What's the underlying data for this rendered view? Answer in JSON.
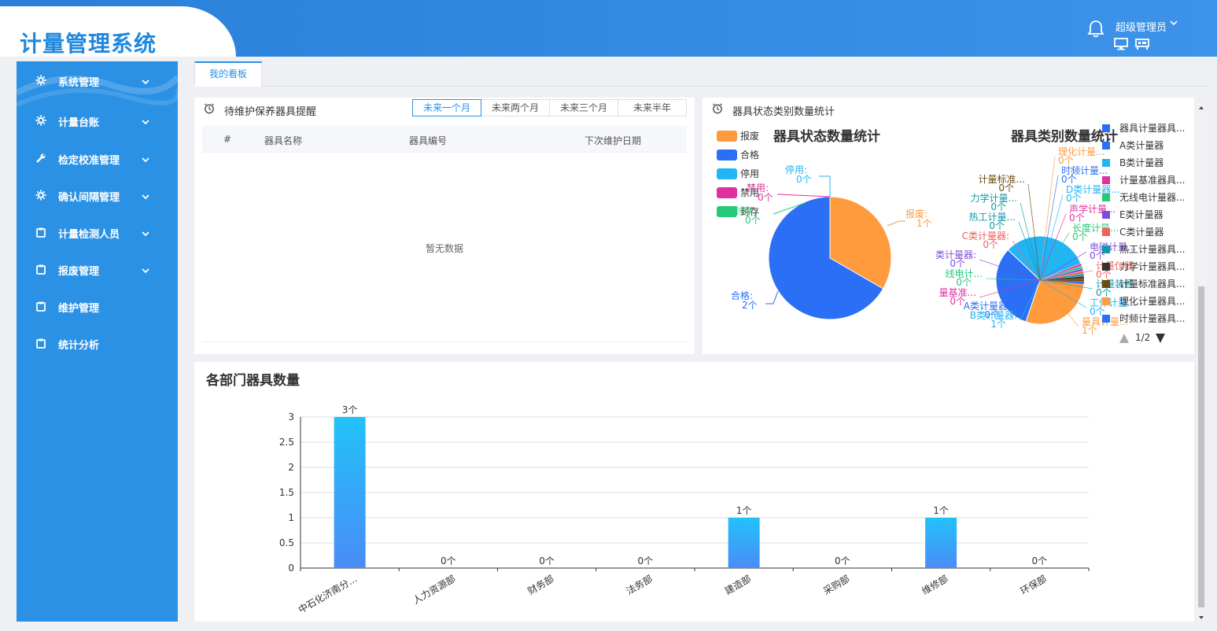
{
  "app": {
    "title": "计量管理系统",
    "user": "超级管理员"
  },
  "colors": {
    "primary": "#2b91e5",
    "header": "#3a8ee6"
  },
  "sidebar": {
    "items": [
      {
        "label": "系统管理",
        "icon": "gear-icon",
        "expandable": true
      },
      {
        "label": "计量台账",
        "icon": "gear-icon",
        "expandable": true
      },
      {
        "label": "检定校准管理",
        "icon": "wrench-icon",
        "expandable": true
      },
      {
        "label": "确认间隔管理",
        "icon": "gear-icon",
        "expandable": true
      },
      {
        "label": "计量检测人员",
        "icon": "clipboard-icon",
        "expandable": true
      },
      {
        "label": "报废管理",
        "icon": "clipboard-icon",
        "expandable": true
      },
      {
        "label": "维护管理",
        "icon": "clipboard-icon",
        "expandable": false
      },
      {
        "label": "统计分析",
        "icon": "clipboard-icon",
        "expandable": false
      }
    ]
  },
  "tabs": [
    {
      "label": "我的看板",
      "active": true
    }
  ],
  "maintenance": {
    "title": "待维护保养器具提醒",
    "ranges": [
      "未来一个月",
      "未来两个月",
      "未来三个月",
      "未来半年"
    ],
    "active_range": 0,
    "columns": [
      "#",
      "器具名称",
      "器具编号",
      "下次维护日期"
    ],
    "empty_text": "暂无数据"
  },
  "status_panel": {
    "title": "器具状态类别数量统计"
  },
  "chart_data": [
    {
      "type": "pie",
      "title": "器具状态数量统计",
      "labels": [
        "报废",
        "合格",
        "停用",
        "禁用",
        "封存"
      ],
      "values": [
        1,
        2,
        0,
        0,
        0
      ],
      "unit": "个",
      "colors": [
        "#ff9a3d",
        "#2a6ff5",
        "#22b5f5",
        "#e0309e",
        "#25c97a"
      ],
      "legend": "left"
    },
    {
      "type": "pie",
      "title": "器具类别数量统计",
      "labels": [
        "计量器具",
        "A类计量器",
        "B类计量器",
        "计量基准器具",
        "无线电计量器",
        "E类计量器",
        "C类计量器",
        "热工计量器具",
        "力学计量器具",
        "计量标准器具",
        "理化计量器具",
        "时频计量器",
        "D类计量器",
        "声学计量器",
        "长度计量器",
        "电磁计量器",
        "计量仪器",
        "计量装置",
        "工作计量器"
      ],
      "values": [
        1,
        0,
        1,
        0,
        0,
        0,
        0,
        0,
        0,
        0,
        0,
        0,
        0,
        0,
        0,
        0,
        0,
        0,
        1
      ],
      "unit": "个",
      "legend": "right",
      "legend_page": "1/2",
      "legend_visible": [
        {
          "label": "器具计量器具...",
          "color": "#2a6ff5"
        },
        {
          "label": "A类计量器",
          "color": "#2a6ff5"
        },
        {
          "label": "B类计量器",
          "color": "#22b5f5"
        },
        {
          "label": "计量基准器具...",
          "color": "#e0309e"
        },
        {
          "label": "无线电计量器...",
          "color": "#25c97a"
        },
        {
          "label": "E类计量器",
          "color": "#7c4ddb"
        },
        {
          "label": "C类计量器",
          "color": "#f25f5c"
        },
        {
          "label": "热工计量器具...",
          "color": "#0e9aa7"
        },
        {
          "label": "力学计量器具...",
          "color": "#333333"
        },
        {
          "label": "计量标准器具...",
          "color": "#6b4c10"
        },
        {
          "label": "理化计量器具...",
          "color": "#ff9a3d"
        },
        {
          "label": "时频计量器具...",
          "color": "#2a6ff5"
        }
      ],
      "slice_labels": [
        {
          "text": "理化计量...",
          "value": "0个",
          "color": "#ff9a3d"
        },
        {
          "text": "时频计量...",
          "value": "0个",
          "color": "#2a6ff5"
        },
        {
          "text": "D类计量器...",
          "value": "0个",
          "color": "#22b5f5"
        },
        {
          "text": "声学计量...",
          "value": "0个",
          "color": "#e0309e"
        },
        {
          "text": "长度计量...",
          "value": "0个",
          "color": "#25c97a"
        },
        {
          "text": "电磁计量...",
          "value": "0个",
          "color": "#7c4ddb"
        },
        {
          "text": "计量仪器",
          "value": "0个",
          "color": "#f25f5c"
        },
        {
          "text": "计量装置",
          "value": "0个",
          "color": "#0e9aa7"
        },
        {
          "text": "工作计量...",
          "value": "0个",
          "color": "#22b5f5"
        },
        {
          "text": "量具计量...",
          "value": "1个",
          "color": "#ff9a3d"
        },
        {
          "text": "计量标准...",
          "value": "0个",
          "color": "#6b4c10"
        },
        {
          "text": "力学计量...",
          "value": "0个",
          "color": "#0e9aa7"
        },
        {
          "text": "热工计量...",
          "value": "0个",
          "color": "#0e9aa7"
        },
        {
          "text": "C类计量器:",
          "value": "0个",
          "color": "#f25f5c"
        },
        {
          "text": "类计量器:",
          "value": "0个",
          "color": "#7c4ddb"
        },
        {
          "text": "线电计...",
          "value": "0个",
          "color": "#25c97a"
        },
        {
          "text": "量基准...",
          "value": "0个",
          "color": "#e0309e"
        },
        {
          "text": "A类计量器:",
          "value": "0个",
          "color": "#2a6ff5"
        },
        {
          "text": "B类计量器:",
          "value": "1个",
          "color": "#22b5f5"
        }
      ]
    },
    {
      "type": "bar",
      "title": "各部门器具数量",
      "categories": [
        "中石化济南分...",
        "人力资源部",
        "财务部",
        "法务部",
        "建造部",
        "采购部",
        "维修部",
        "环保部"
      ],
      "values": [
        3,
        0,
        0,
        0,
        1,
        0,
        1,
        0
      ],
      "unit": "个",
      "ylim": [
        0,
        3
      ],
      "yticks": [
        "0",
        "0.5",
        "1",
        "1.5",
        "2",
        "2.5",
        "3"
      ],
      "grid": true
    }
  ]
}
